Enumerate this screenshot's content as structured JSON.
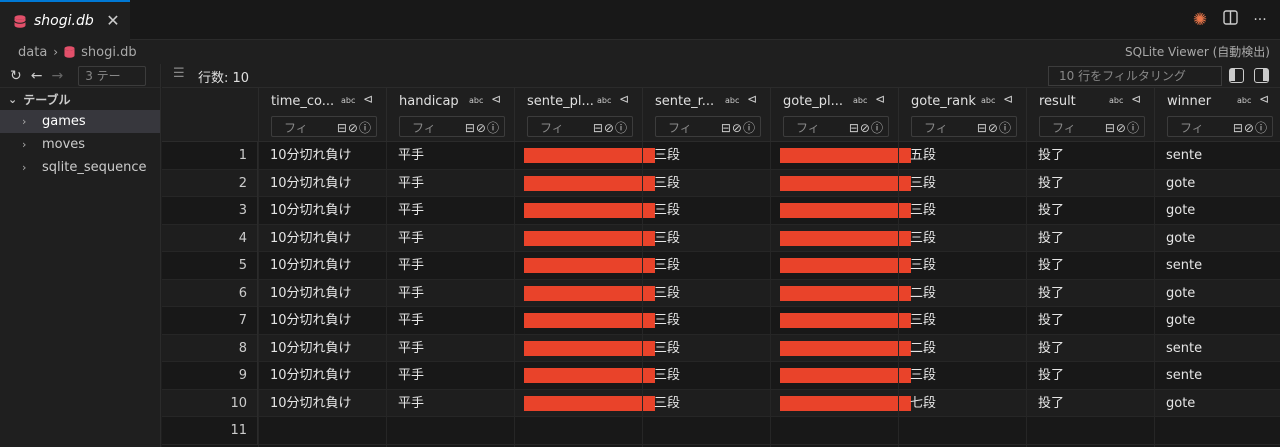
{
  "tab": {
    "title": "shogi.db"
  },
  "breadcrumb": {
    "folder": "data",
    "file": "shogi.db"
  },
  "viewer": {
    "label": "SQLite Viewer (自動検出)"
  },
  "sidebar": {
    "search_placeholder": "3 テー",
    "section": "テーブル",
    "items": [
      {
        "label": "games",
        "active": true
      },
      {
        "label": "moves",
        "active": false
      },
      {
        "label": "sqlite_sequence",
        "active": false
      }
    ]
  },
  "toolbar": {
    "row_count": "行数: 10",
    "filter_placeholder": "10 行をフィルタリング"
  },
  "table": {
    "filter_placeholder": "フィ",
    "type_badge": "abc",
    "columns": [
      {
        "label": "time_co..."
      },
      {
        "label": "handicap"
      },
      {
        "label": "sente_pl..."
      },
      {
        "label": "sente_r..."
      },
      {
        "label": "gote_pl..."
      },
      {
        "label": "gote_rank"
      },
      {
        "label": "result"
      },
      {
        "label": "winner"
      }
    ],
    "rows": [
      {
        "num": "1",
        "time_control": "10分切れ負け",
        "handicap": "平手",
        "sente_rank": "三段",
        "gote_rank": "五段",
        "result": "投了",
        "winner": "sente"
      },
      {
        "num": "2",
        "time_control": "10分切れ負け",
        "handicap": "平手",
        "sente_rank": "三段",
        "gote_rank": "三段",
        "result": "投了",
        "winner": "gote"
      },
      {
        "num": "3",
        "time_control": "10分切れ負け",
        "handicap": "平手",
        "sente_rank": "三段",
        "gote_rank": "三段",
        "result": "投了",
        "winner": "gote"
      },
      {
        "num": "4",
        "time_control": "10分切れ負け",
        "handicap": "平手",
        "sente_rank": "三段",
        "gote_rank": "三段",
        "result": "投了",
        "winner": "gote"
      },
      {
        "num": "5",
        "time_control": "10分切れ負け",
        "handicap": "平手",
        "sente_rank": "三段",
        "gote_rank": "三段",
        "result": "投了",
        "winner": "sente"
      },
      {
        "num": "6",
        "time_control": "10分切れ負け",
        "handicap": "平手",
        "sente_rank": "三段",
        "gote_rank": "二段",
        "result": "投了",
        "winner": "gote"
      },
      {
        "num": "7",
        "time_control": "10分切れ負け",
        "handicap": "平手",
        "sente_rank": "三段",
        "gote_rank": "三段",
        "result": "投了",
        "winner": "gote"
      },
      {
        "num": "8",
        "time_control": "10分切れ負け",
        "handicap": "平手",
        "sente_rank": "三段",
        "gote_rank": "二段",
        "result": "投了",
        "winner": "sente"
      },
      {
        "num": "9",
        "time_control": "10分切れ負け",
        "handicap": "平手",
        "sente_rank": "三段",
        "gote_rank": "三段",
        "result": "投了",
        "winner": "sente"
      },
      {
        "num": "10",
        "time_control": "10分切れ負け",
        "handicap": "平手",
        "sente_rank": "三段",
        "gote_rank": "七段",
        "result": "投了",
        "winner": "gote"
      }
    ],
    "new_row_num": "11"
  },
  "colors": {
    "accent": "#0078d4",
    "redaction": "#e9432a",
    "db_icon": "#e2506a",
    "spark": "#e8764a"
  },
  "icons": [
    "database-icon",
    "close-icon",
    "spark-icon",
    "split-editor-icon",
    "more-icon",
    "refresh-icon",
    "back-icon",
    "forward-icon",
    "chevron-icon",
    "pin-icon",
    "filter-list-icon",
    "layout-icon"
  ]
}
